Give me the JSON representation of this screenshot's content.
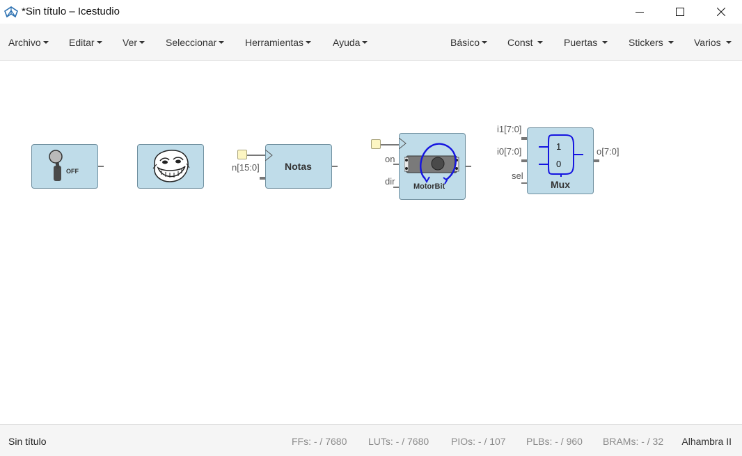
{
  "window": {
    "title": "*Sin título – Icestudio"
  },
  "menu_left": [
    "Archivo",
    "Editar",
    "Ver",
    "Seleccionar",
    "Herramientas",
    "Ayuda"
  ],
  "menu_right": [
    "Básico",
    "Const",
    "Puertas",
    "Stickers",
    "Varios"
  ],
  "blocks": {
    "switch": {
      "label": "OFF",
      "icon": "toggle-switch-icon"
    },
    "troll": {
      "icon": "troll-face-icon"
    },
    "notas": {
      "title": "Notas",
      "input": "n[15:0]"
    },
    "motorbit": {
      "title": "MotorBit",
      "inputs": [
        "on",
        "dir"
      ],
      "icon": "servo-motor-icon"
    },
    "mux": {
      "title": "Mux",
      "inputs": [
        "i1[7:0]",
        "i0[7:0]",
        "sel"
      ],
      "output": "o[7:0]",
      "symbol_labels": [
        "1",
        "0"
      ]
    }
  },
  "status": {
    "file": "Sin título",
    "ffs": "FFs:  - / 7680",
    "luts": "LUTs:  - / 7680",
    "pios": "PIOs:  - / 107",
    "plbs": "PLBs:  - / 960",
    "brams": "BRAMs:  - / 32",
    "board": "Alhambra II"
  },
  "colors": {
    "block_fill": "#bfdce9",
    "block_border": "#6f8f9f",
    "port_fill": "#fdf6c3",
    "motor_arrow": "#1515e0"
  }
}
